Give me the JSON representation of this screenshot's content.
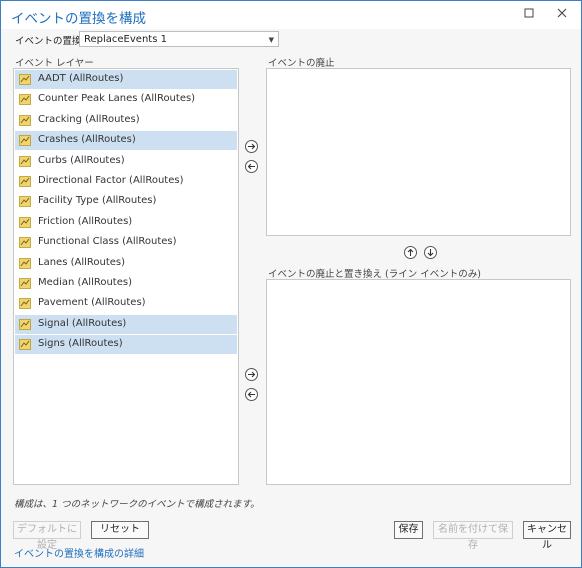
{
  "window": {
    "title": "イベントの置換を構成",
    "maximize_icon": "maximize-icon",
    "close_icon": "close-icon"
  },
  "replace": {
    "label": "イベントの置換",
    "value": "ReplaceEvents 1"
  },
  "event_layers": {
    "label": "イベント レイヤー",
    "items": [
      {
        "label": "AADT (AllRoutes)",
        "selected": true
      },
      {
        "label": "Counter Peak Lanes (AllRoutes)",
        "selected": false
      },
      {
        "label": "Cracking (AllRoutes)",
        "selected": false
      },
      {
        "label": "Crashes (AllRoutes)",
        "selected": true
      },
      {
        "label": "Curbs (AllRoutes)",
        "selected": false
      },
      {
        "label": "Directional Factor (AllRoutes)",
        "selected": false
      },
      {
        "label": "Facility Type (AllRoutes)",
        "selected": false
      },
      {
        "label": "Friction (AllRoutes)",
        "selected": false
      },
      {
        "label": "Functional Class (AllRoutes)",
        "selected": false
      },
      {
        "label": "Lanes (AllRoutes)",
        "selected": false
      },
      {
        "label": "Median (AllRoutes)",
        "selected": false
      },
      {
        "label": "Pavement (AllRoutes)",
        "selected": false
      },
      {
        "label": "Signal (AllRoutes)",
        "selected": true
      },
      {
        "label": "Signs (AllRoutes)",
        "selected": true
      }
    ]
  },
  "retire": {
    "label": "イベントの廃止"
  },
  "retire_replace": {
    "label": "イベントの廃止と置き換え (ライン イベントのみ)"
  },
  "note": "構成は、1 つのネットワークのイベントで構成されます。",
  "buttons": {
    "default": "デフォルトに設定",
    "reset": "リセット",
    "save": "保存",
    "save_as": "名前を付けて保存",
    "cancel": "キャンセル"
  },
  "help_link": "イベントの置換を構成の詳細",
  "colors": {
    "accent": "#1f6fbf",
    "selection": "#cde0f2"
  }
}
